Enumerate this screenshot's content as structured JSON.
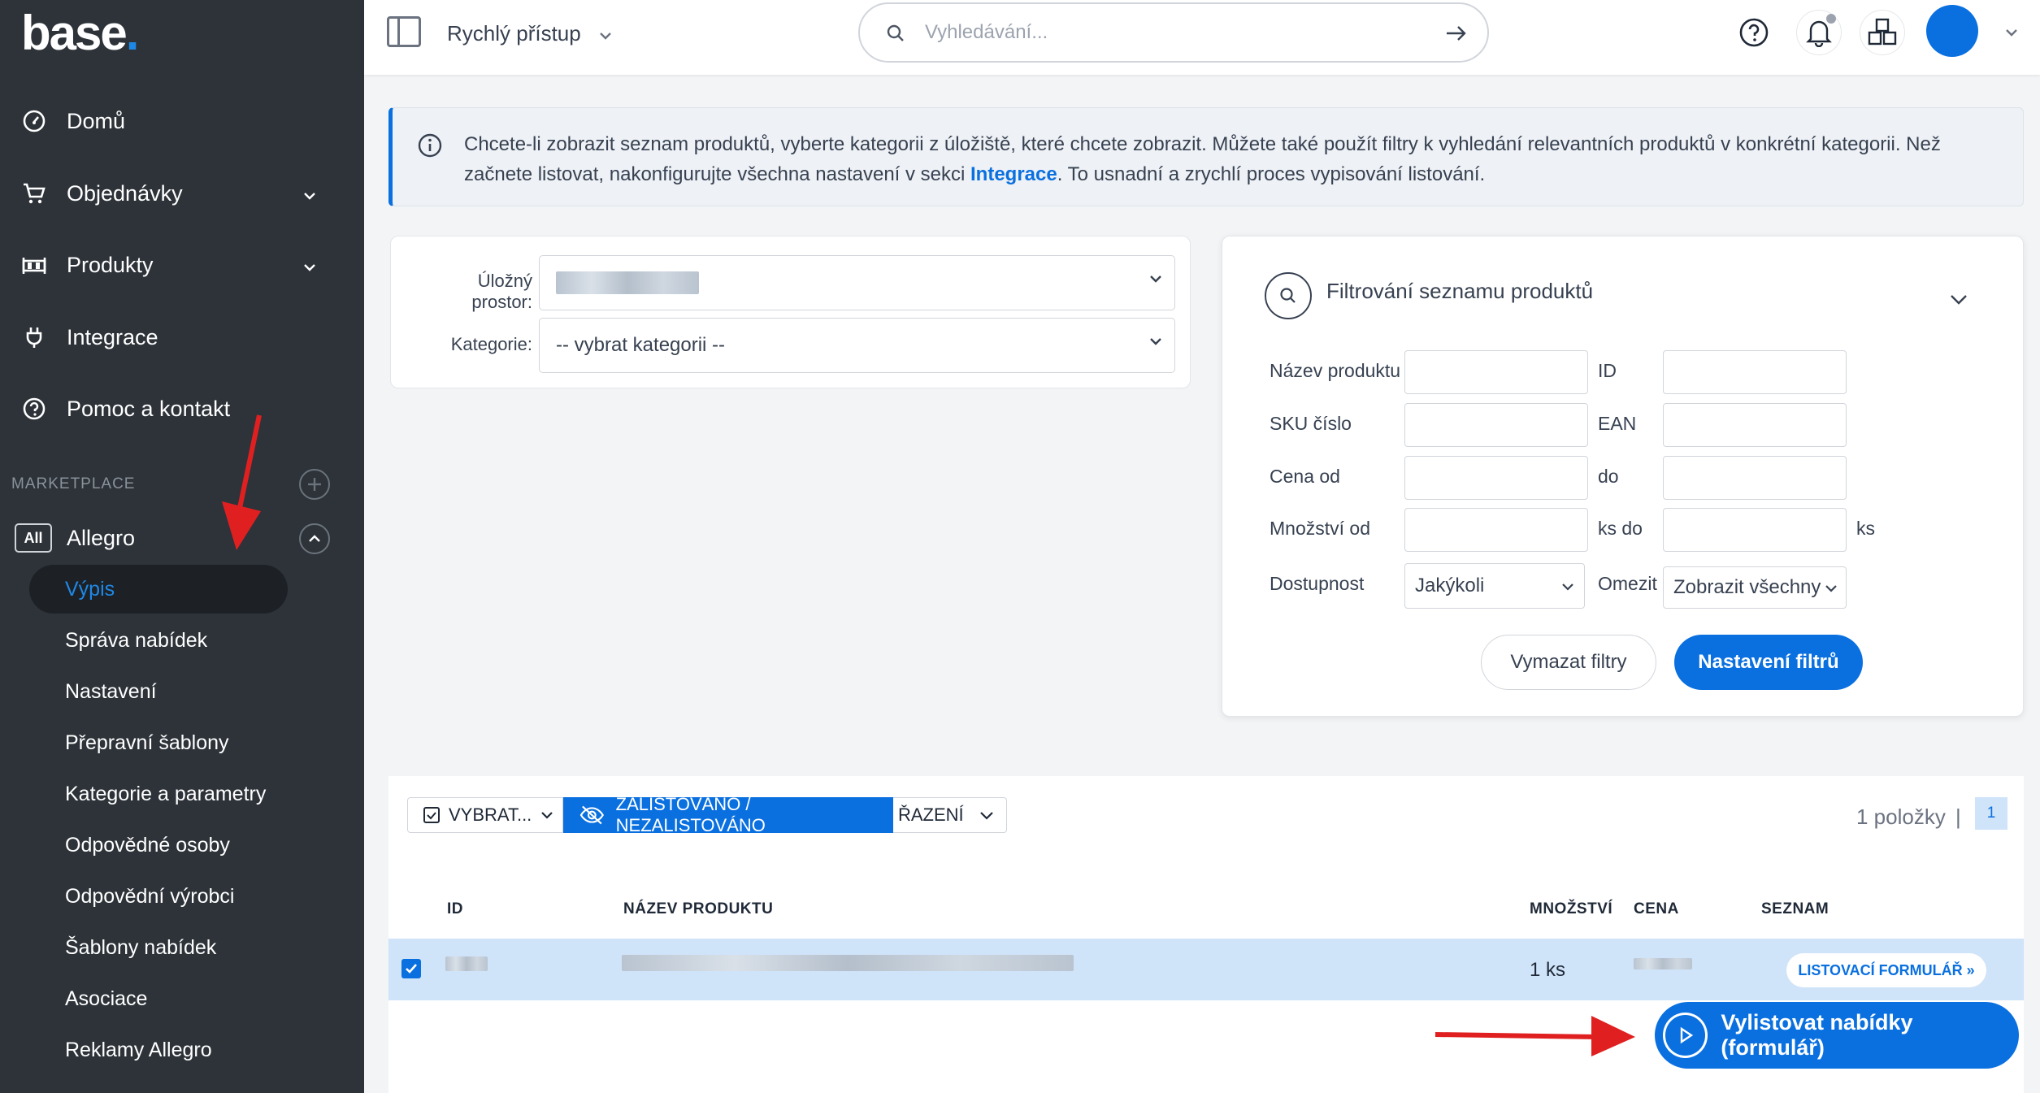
{
  "sidebar": {
    "logo": "base",
    "logo_dot": ".",
    "nav": [
      {
        "label": "Domů",
        "icon": "dashboard-icon"
      },
      {
        "label": "Objednávky",
        "icon": "cart-icon"
      },
      {
        "label": "Produkty",
        "icon": "products-icon"
      },
      {
        "label": "Integrace",
        "icon": "plug-icon"
      },
      {
        "label": "Pomoc a kontakt",
        "icon": "help-icon"
      }
    ],
    "section_label": "MARKETPLACE",
    "marketplace": {
      "badge": "All",
      "name": "Allegro"
    },
    "sub_items": [
      "Výpis",
      "Správa nabídek",
      "Nastavení",
      "Přepravní šablony",
      "Kategorie a parametry",
      "Odpovědné osoby",
      "Odpovědní výrobci",
      "Šablony nabídek",
      "Asociace",
      "Reklamy Allegro"
    ]
  },
  "topbar": {
    "quick_access": "Rychlý přístup",
    "search_placeholder": "Vyhledávání..."
  },
  "alert": {
    "text_before": "Chcete-li zobrazit seznam produktů, vyberte kategorii z úložiště, které chcete zobrazit. Můžete také použít filtry k vyhledání relevantních produktů v konkrétní kategorii. Než začnete listovat, nakonfigurujte všechna nastavení v sekci ",
    "link": "Integrace",
    "text_after": ". To usnadní a zrychlí proces vypisování listování."
  },
  "storage": {
    "storage_label_1": "Úložný",
    "storage_label_2": "prostor:",
    "category_label": "Kategorie:",
    "category_value": "-- vybrat kategorii --"
  },
  "filters": {
    "title": "Filtrování seznamu produktů",
    "product_name": "Název produktu",
    "id": "ID",
    "sku": "SKU číslo",
    "ean": "EAN",
    "price_from": "Cena od",
    "price_to": "do",
    "qty_from": "Množství od",
    "qty_to": "ks do",
    "qty_unit": "ks",
    "availability": "Dostupnost",
    "availability_value": "Jakýkoli",
    "limit": "Omezit",
    "limit_value": "Zobrazit všechny",
    "clear": "Vymazat filtry",
    "settings": "Nastavení filtrů"
  },
  "table": {
    "select_btn": "VYBRAT...",
    "listed_btn": "ZALISTOVÁNO / NEZALISTOVÁNO",
    "sort_btn": "ŘAZENÍ",
    "items_count": "1 položky",
    "separator": "|",
    "page": "1",
    "headers": {
      "id": "ID",
      "name": "NÁZEV PRODUKTU",
      "qty": "MNOŽSTVÍ",
      "price": "CENA",
      "list": "SEZNAM"
    },
    "row": {
      "qty": "1 ks",
      "action": "LISTOVACÍ FORMULÁŘ »",
      "checked": true
    }
  },
  "cta": "Vylistovat nabídky (formulář)",
  "colors": {
    "accent": "#0a70e0",
    "sidebar": "#2d3339",
    "annotation_arrow": "#e02020"
  }
}
